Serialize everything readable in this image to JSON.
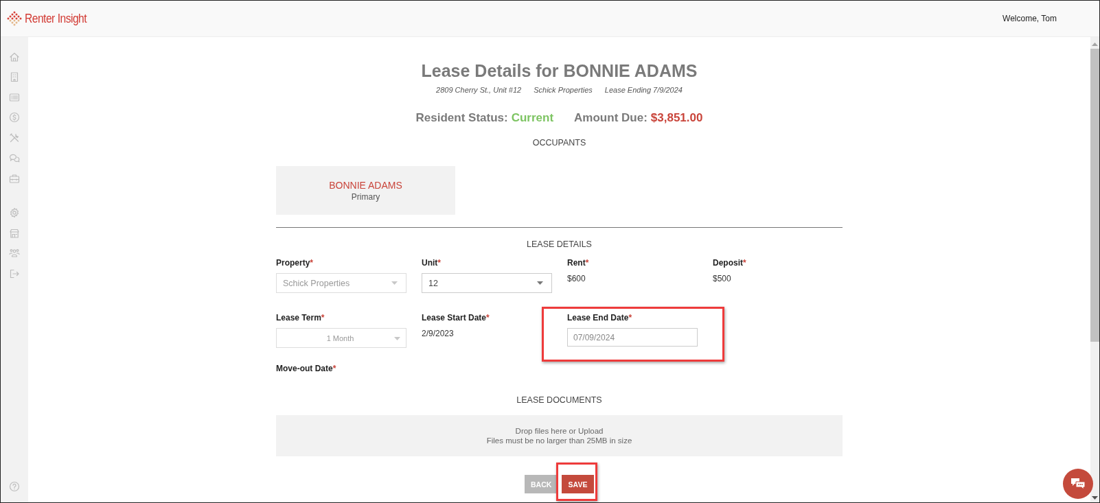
{
  "header": {
    "logo_text": "Renter Insight",
    "welcome": "Welcome, Tom"
  },
  "title": "Lease Details for **BONNIE ADAMS**",
  "subtitle": [
    "2809 Cherry St., Unit #12",
    "Schick Properties",
    "Lease Ending 7/9/2024"
  ],
  "status": [
    {
      "label": "Resident Status:",
      "value": "Current",
      "color": "#7dc462"
    },
    {
      "label": "Amount Due:",
      "value": "$3,851.00",
      "color": "#c9443a"
    }
  ],
  "occupants": {
    "heading": "OCCUPANTS",
    "cards": [
      {
        "name": "BONNIE ADAMS",
        "role": "Primary"
      }
    ]
  },
  "lease_details": {
    "heading": "LEASE DETAILS",
    "rows": [
      [
        {
          "label": "Property",
          "required_mark": "*",
          "kind": "select",
          "value": "Schick Properties",
          "disabled": true
        },
        {
          "label": "Unit",
          "required_mark": "*",
          "kind": "select",
          "value": "12",
          "disabled": false
        },
        {
          "label": "Rent",
          "required_mark": "*",
          "kind": "text",
          "value": "$600"
        },
        {
          "label": "Deposit",
          "required_mark": "*",
          "kind": "text",
          "value": "$500"
        }
      ],
      [
        {
          "label": "Lease Term",
          "required_mark": "*",
          "kind": "select",
          "value": "1 Month",
          "disabled": true,
          "centered": true
        },
        {
          "label": "Lease Start Date",
          "required_mark": "*",
          "kind": "text",
          "value": "2/9/2023"
        },
        {
          "label": "Lease End Date",
          "required_mark": "*",
          "kind": "input",
          "value": "07/09/2024",
          "highlighted": true
        }
      ],
      [
        {
          "label": "Move-out Date",
          "required_mark": "*",
          "kind": "empty"
        }
      ]
    ]
  },
  "documents": {
    "heading": "LEASE DOCUMENTS",
    "dropzone": [
      "Drop files here or Upload",
      "Files must be no larger than 25MB in size"
    ]
  },
  "buttons": [
    {
      "label": "BACK",
      "kind": "secondary"
    },
    {
      "label": "SAVE",
      "kind": "primary",
      "highlighted": true
    }
  ]
}
